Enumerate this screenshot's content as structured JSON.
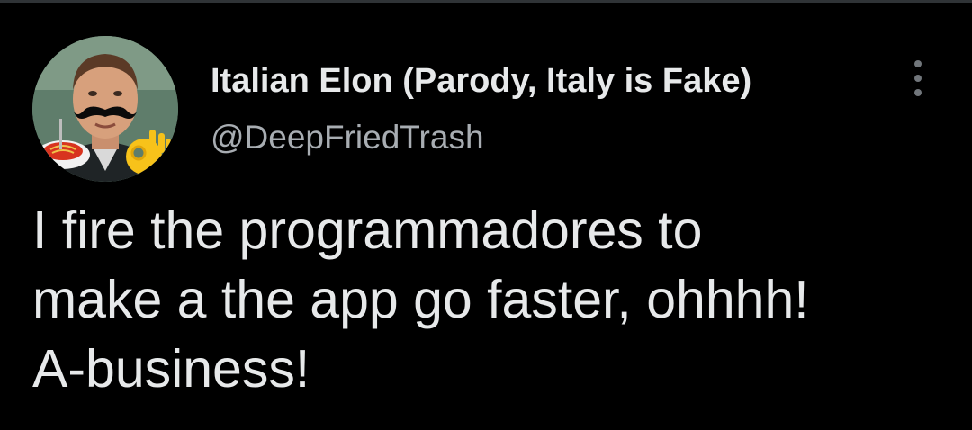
{
  "tweet": {
    "author": {
      "display_name": "Italian Elon (Parody, Italy is Fake)",
      "handle": "@DeepFriedTrash",
      "avatar_icon": "profile-avatar"
    },
    "menu_icon": "more-vertical-icon",
    "text": "I fire the programmadores to\nmake a the app go faster, ohhhh!\nA-business!"
  },
  "colors": {
    "background": "#000000",
    "primary_text": "#e7e9ea",
    "secondary_text": "#a8adb2"
  }
}
